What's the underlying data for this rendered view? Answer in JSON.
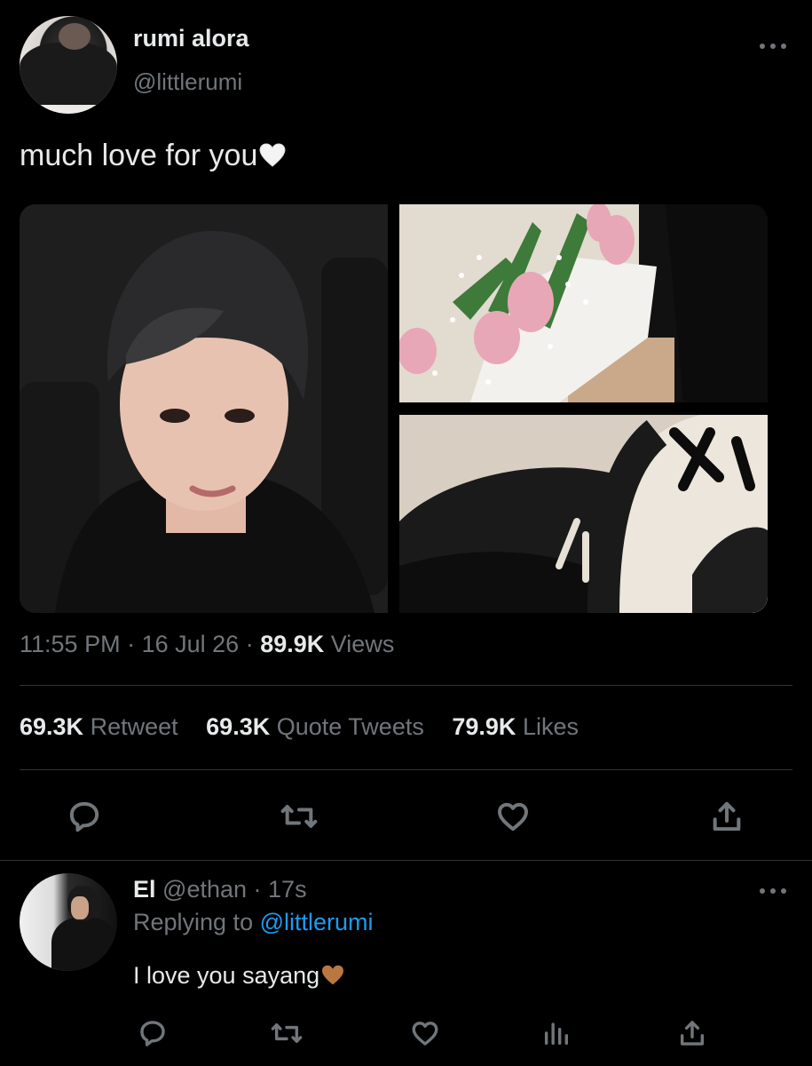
{
  "tweet": {
    "display_name": "rumi alora",
    "handle": "@littlerumi",
    "text": "much love for you",
    "time": "11:55 PM",
    "date": "16 Jul 26",
    "views_count": "89.9K",
    "views_label": "Views",
    "retweets_count": "69.3K",
    "retweets_label": "Retweet",
    "quotes_count": "69.3K",
    "quotes_label": "Quote Tweets",
    "likes_count": "79.9K",
    "likes_label": "Likes",
    "emoji": "white-heart",
    "media": [
      "portrait-photo",
      "flower-bouquet-photo",
      "ny-cap-photo"
    ]
  },
  "reply": {
    "display_name": "El",
    "handle": "@ethan",
    "time": "17s",
    "replying_prefix": "Replying to",
    "replying_to": "@littlerumi",
    "text": "I love you sayang",
    "emoji": "brown-heart"
  },
  "colors": {
    "background": "#000000",
    "text": "#e7e9ea",
    "secondary": "#71767b",
    "link": "#1d9bf0",
    "divider": "#2f3336"
  }
}
